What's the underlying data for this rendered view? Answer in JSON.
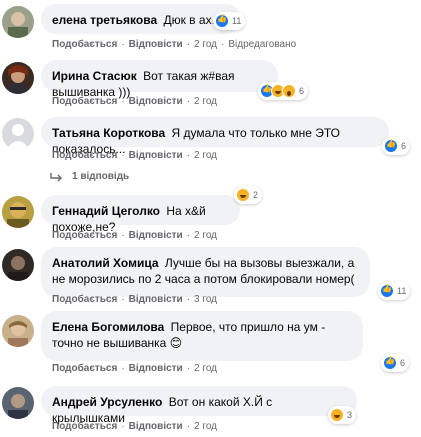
{
  "comments": [
    {
      "author": "елена третьякова",
      "text": "Дюк в ах.е(",
      "reaction_count": "11",
      "reactions": [
        "like"
      ],
      "like": "Подобається",
      "reply": "Відповісти",
      "time": "2 год",
      "edited": "Відредаговано"
    },
    {
      "author": "Ирина Стасюк",
      "text": "Вот такая ж#вая вышиванка )))",
      "reaction_count": "6",
      "reactions": [
        "like",
        "haha",
        "wow"
      ],
      "like": "Подобається",
      "reply": "Відповісти",
      "time": "2 год"
    },
    {
      "author": "Татьяна Короткова",
      "text": "Я думала что только мне ЭТО показалось...",
      "reaction_count": "6",
      "reactions": [
        "like"
      ],
      "like": "Подобається",
      "reply": "Відповісти",
      "time": "2 год",
      "replies_label": "1 відповідь"
    },
    {
      "author": "Геннадий Цеголко",
      "text": "На х&й похоже,не?",
      "reaction_count": "2",
      "reactions": [
        "haha"
      ],
      "like": "Подобається",
      "reply": "Відповісти",
      "time": "2 год"
    },
    {
      "author": "Анатолий Хомица",
      "text": "Лучше бы на вызовы выезжали, а не морозились по 2 часа а потом блокировали номер(",
      "reaction_count": "11",
      "reactions": [
        "like"
      ],
      "like": "Подобається",
      "reply": "Відповісти",
      "time": "3 год"
    },
    {
      "author": "Елена Богомилова",
      "text": "Первое, что пришло на ум - точно не вышиванка 😊",
      "reaction_count": "6",
      "reactions": [
        "like"
      ],
      "like": "Подобається",
      "reply": "Відповісти",
      "time": "2 год"
    },
    {
      "author": "Андрей Урсуленко",
      "text": "Вот он какой Х.Й с крылышками",
      "reaction_count": "3",
      "reactions": [
        "haha"
      ],
      "like": "Подобається",
      "reply": "Відповісти",
      "time": "2 год"
    }
  ],
  "colors": {
    "bubble": "#f0f2f5",
    "meta": "#65676b",
    "like": "#1877f2",
    "haha": "#f7b125"
  }
}
